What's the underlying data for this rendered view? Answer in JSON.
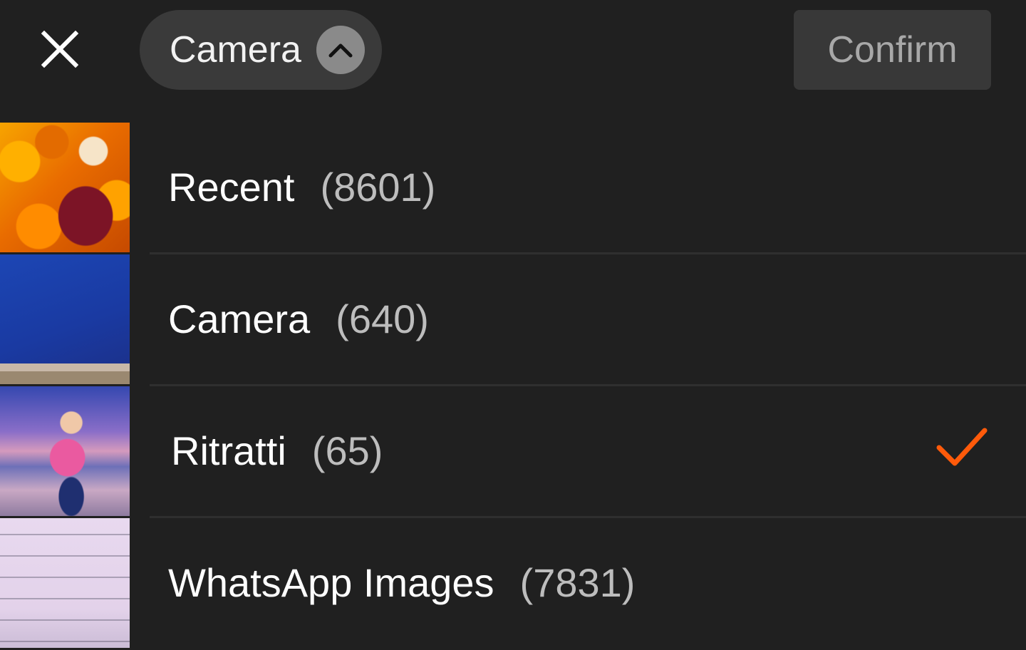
{
  "header": {
    "close_icon": "close-icon",
    "album_selector": {
      "label": "Camera",
      "chevron_icon": "chevron-up-icon"
    },
    "confirm_label": "Confirm"
  },
  "albums": [
    {
      "name": "Recent",
      "count": "(8601)",
      "selected": false,
      "thumbnail": "woman-autumn-leaves-photo"
    },
    {
      "name": "Camera",
      "count": "(640)",
      "selected": false,
      "thumbnail": "blue-sky-photo"
    },
    {
      "name": "Ritratti",
      "count": "(65)",
      "selected": true,
      "thumbnail": "woman-beach-sunset-photo"
    },
    {
      "name": "WhatsApp Images",
      "count": "(7831)",
      "selected": false,
      "thumbnail": "document-photo"
    }
  ],
  "colors": {
    "background": "#202020",
    "selector_bg": "#3a3a3a",
    "confirm_bg": "#383838",
    "confirm_text": "#a8a8a8",
    "check_accent": "#ff5a0a"
  }
}
